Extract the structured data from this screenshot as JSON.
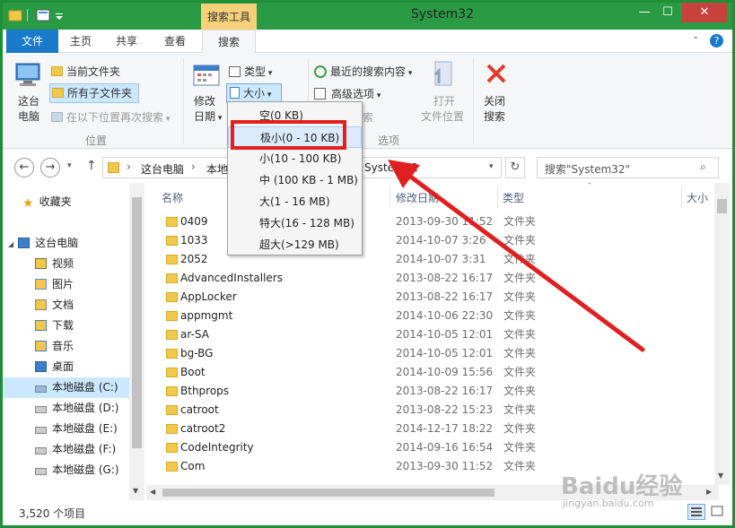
{
  "titlebar": {
    "title": "System32",
    "context_tab": "搜索工具",
    "minimize": "—",
    "maximize": "☐",
    "close": "✕"
  },
  "tabs": [
    {
      "label": "文件"
    },
    {
      "label": "主页"
    },
    {
      "label": "共享"
    },
    {
      "label": "查看"
    },
    {
      "label": "搜索"
    }
  ],
  "ribbon": {
    "this_pc": "这台\n电脑",
    "this_pc_l1": "这台",
    "this_pc_l2": "电脑",
    "current_folder": "当前文件夹",
    "all_subfolders": "所有子文件夹",
    "search_again": "在以下位置再次搜索",
    "location_group": "位置",
    "modified_l1": "修改",
    "modified_l2": "日期",
    "type_btn": "类型",
    "size_btn": "大小",
    "recent_searches": "最近的搜索内容",
    "advanced_options": "高级选项",
    "options_group": "选项",
    "open_location_l1": "打开",
    "open_location_l2": "文件位置",
    "close_search_l1": "关闭",
    "close_search_l2": "搜索"
  },
  "address": {
    "crumbs": [
      "这台电脑",
      "本地",
      "System32"
    ],
    "search_placeholder": "搜索\"System32\""
  },
  "nav": {
    "favorites": "收藏夹",
    "this_pc": "这台电脑",
    "items": [
      {
        "label": "视频"
      },
      {
        "label": "图片"
      },
      {
        "label": "文档"
      },
      {
        "label": "下载"
      },
      {
        "label": "音乐"
      },
      {
        "label": "桌面"
      },
      {
        "label": "本地磁盘 (C:)"
      },
      {
        "label": "本地磁盘 (D:)"
      },
      {
        "label": "本地磁盘 (E:)"
      },
      {
        "label": "本地磁盘 (F:)"
      },
      {
        "label": "本地磁盘 (G:)"
      }
    ]
  },
  "columns": {
    "name": "名称",
    "date": "修改日期",
    "type": "类型",
    "size": "大小"
  },
  "files": [
    {
      "name": "0409",
      "date": "2013-09-30 11:52",
      "type": "文件夹"
    },
    {
      "name": "1033",
      "date": "2014-10-07 3:26",
      "type": "文件夹"
    },
    {
      "name": "2052",
      "date": "2014-10-07 3:31",
      "type": "文件夹"
    },
    {
      "name": "AdvancedInstallers",
      "date": "2013-08-22 16:17",
      "type": "文件夹"
    },
    {
      "name": "AppLocker",
      "date": "2013-08-22 16:17",
      "type": "文件夹"
    },
    {
      "name": "appmgmt",
      "date": "2014-10-06 22:30",
      "type": "文件夹"
    },
    {
      "name": "ar-SA",
      "date": "2014-10-05 12:01",
      "type": "文件夹"
    },
    {
      "name": "bg-BG",
      "date": "2014-10-05 12:01",
      "type": "文件夹"
    },
    {
      "name": "Boot",
      "date": "2014-10-09 15:56",
      "type": "文件夹"
    },
    {
      "name": "Bthprops",
      "date": "2013-08-22 16:17",
      "type": "文件夹"
    },
    {
      "name": "catroot",
      "date": "2013-08-22 15:23",
      "type": "文件夹"
    },
    {
      "name": "catroot2",
      "date": "2014-12-17 18:22",
      "type": "文件夹"
    },
    {
      "name": "CodeIntegrity",
      "date": "2014-09-16 16:54",
      "type": "文件夹"
    },
    {
      "name": "Com",
      "date": "2013-09-30 11:52",
      "type": "文件夹"
    }
  ],
  "size_menu": [
    {
      "label": "空(0 KB)"
    },
    {
      "label": "极小(0 - 10 KB)"
    },
    {
      "label": "小(10 - 100 KB)"
    },
    {
      "label": "中 (100 KB - 1 MB)"
    },
    {
      "label": "大(1 - 16 MB)"
    },
    {
      "label": "特大(16 - 128 MB)"
    },
    {
      "label": "超大(>129 MB)"
    }
  ],
  "status": {
    "count": "3,520 个项目"
  },
  "watermark": {
    "brand": "Baidu经验",
    "url": "jingyan.baidu.com"
  },
  "colors": {
    "accent": "#1979ca",
    "titlebar": "#2b9a45",
    "context_tab": "#f6d17a",
    "annotation": "#e02020"
  }
}
